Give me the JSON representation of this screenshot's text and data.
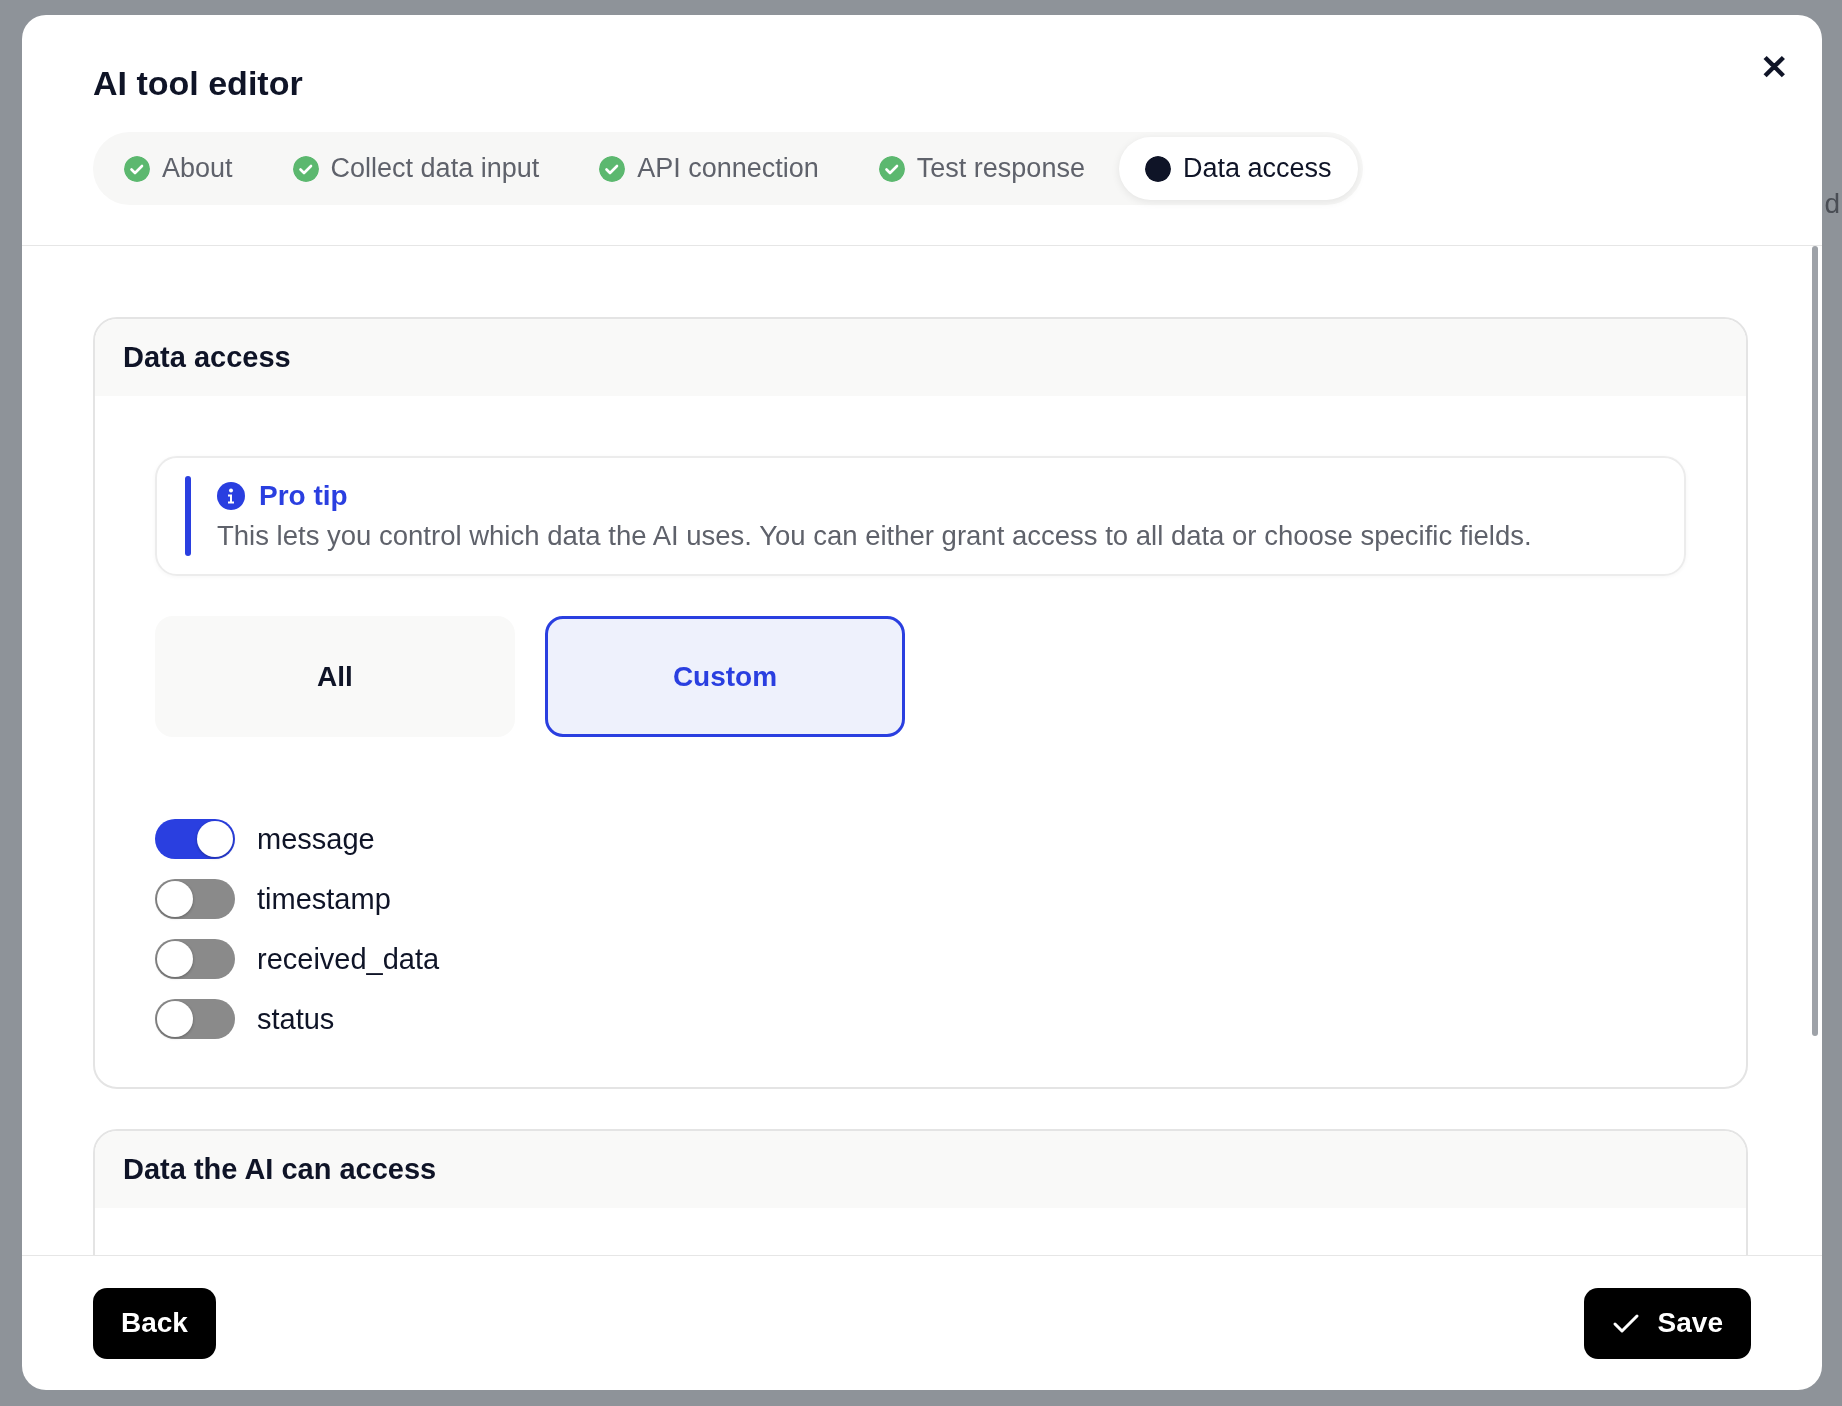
{
  "background": {
    "fragment": "d"
  },
  "modal": {
    "title": "AI tool editor",
    "close": "✕"
  },
  "steps": [
    {
      "label": "About",
      "done": true,
      "selected": false
    },
    {
      "label": "Collect data input",
      "done": true,
      "selected": false
    },
    {
      "label": "API connection",
      "done": true,
      "selected": false
    },
    {
      "label": "Test response",
      "done": true,
      "selected": false
    },
    {
      "label": "Data access",
      "done": false,
      "selected": true
    }
  ],
  "data_access": {
    "title": "Data access",
    "tip": {
      "title": "Pro tip",
      "text": "This lets you control which data the AI uses. You can either grant access to all data or choose specific fields."
    },
    "options": [
      {
        "label": "All",
        "selected": false
      },
      {
        "label": "Custom",
        "selected": true
      }
    ],
    "fields": [
      {
        "label": "message",
        "on": true
      },
      {
        "label": "timestamp",
        "on": false
      },
      {
        "label": "received_data",
        "on": false
      },
      {
        "label": "status",
        "on": false
      }
    ]
  },
  "accessible_data": {
    "title": "Data the AI can access"
  },
  "footer": {
    "back": "Back",
    "save": "Save"
  }
}
